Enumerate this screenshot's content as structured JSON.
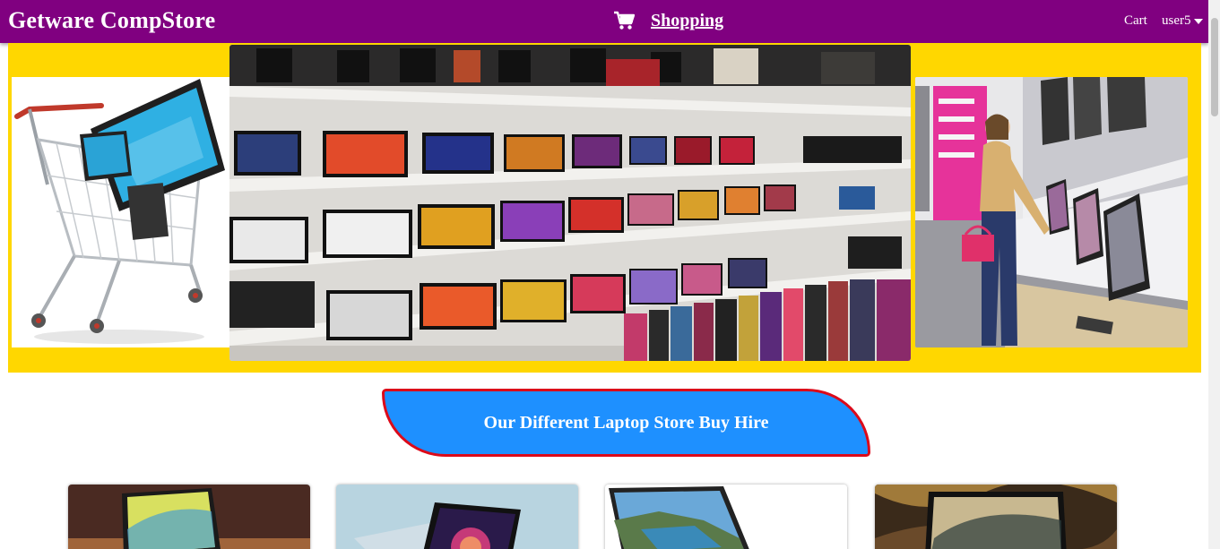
{
  "navbar": {
    "brand": "Getware CompStore",
    "center_icon": "shopping-cart-icon",
    "center_link": "Shopping",
    "cart_link": "Cart",
    "user_menu": "user5",
    "background": "#800080"
  },
  "hero": {
    "background": "#ffd700",
    "images": [
      {
        "name": "cart-with-computers-image"
      },
      {
        "name": "laptop-store-shelves-image"
      },
      {
        "name": "woman-shopping-monitors-image"
      }
    ]
  },
  "banner": {
    "text": "Our Different Laptop Store Buy Hire",
    "background": "#1e90ff",
    "border_color": "#dc0a1a"
  },
  "products": [
    {
      "name": "laptop-product-1-image"
    },
    {
      "name": "laptop-product-2-image"
    },
    {
      "name": "laptop-product-3-image"
    },
    {
      "name": "laptop-product-4-image"
    }
  ]
}
